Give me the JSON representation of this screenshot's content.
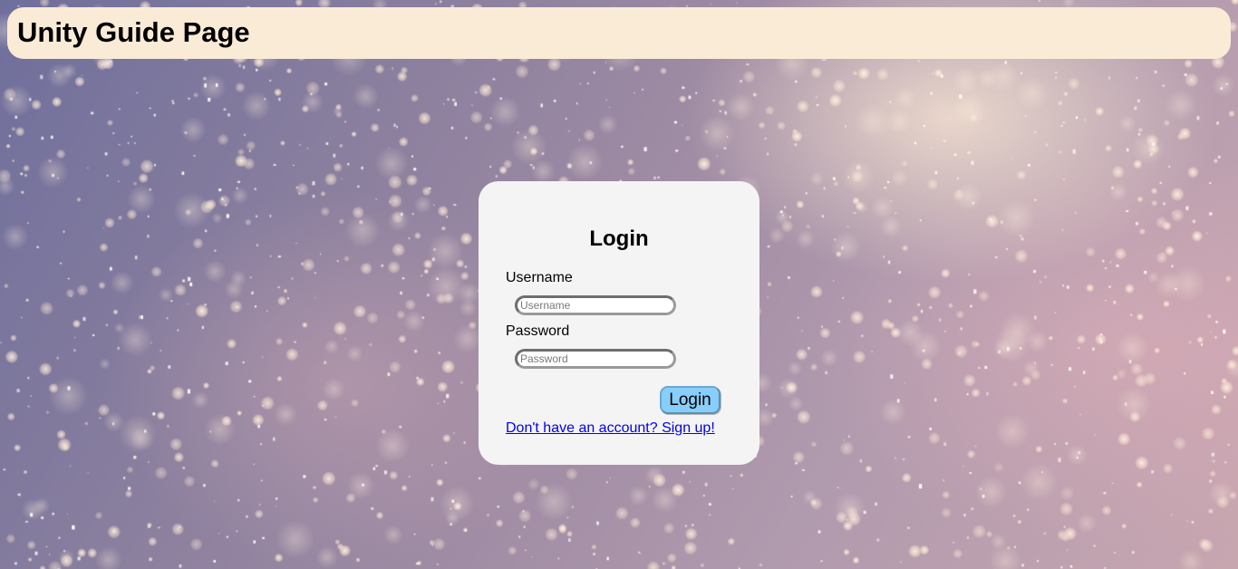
{
  "header": {
    "title": "Unity Guide Page"
  },
  "login": {
    "title": "Login",
    "username_label": "Username",
    "username_placeholder": "Username",
    "username_value": "",
    "password_label": "Password",
    "password_placeholder": "Password",
    "password_value": "",
    "submit_label": "Login",
    "signup_link": "Don't have an account? Sign up!"
  },
  "colors": {
    "header_bg": "#faebd7",
    "card_bg": "#f4f4f4",
    "button_bg": "#87cefa",
    "link": "#0000ee"
  }
}
